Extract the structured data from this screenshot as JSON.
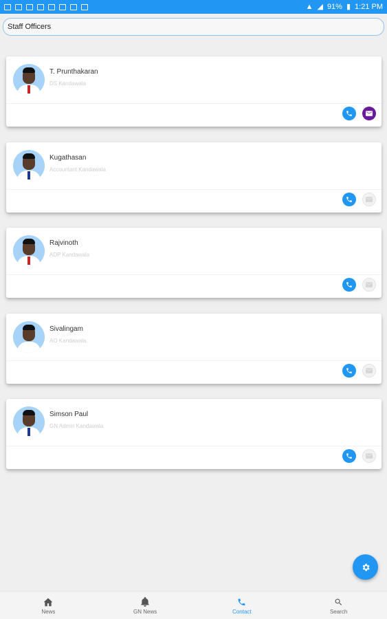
{
  "status_bar": {
    "battery": "91%",
    "time": "1:21 PM"
  },
  "search": {
    "value": "Staff Officers",
    "placeholder": "Staff Officers"
  },
  "contacts": [
    {
      "name": "T. Prunthakaran",
      "role": "DS Kandawala",
      "tie": "red",
      "email_active": true
    },
    {
      "name": "Kugathasan",
      "role": "Accountant Kandawala",
      "tie": "blue",
      "email_active": false
    },
    {
      "name": "Rajvinoth",
      "role": "ADP Kandawala",
      "tie": "red",
      "email_active": false
    },
    {
      "name": "Sivalingam",
      "role": "AO Kandawala",
      "tie": "none",
      "email_active": false
    },
    {
      "name": "Simson Paul",
      "role": "GN Admin Kandawala",
      "tie": "blue",
      "email_active": false
    }
  ],
  "bottom_nav": [
    {
      "label": "News",
      "icon": "home-icon",
      "active": false
    },
    {
      "label": "GN News",
      "icon": "bell-icon",
      "active": false
    },
    {
      "label": "Contact",
      "icon": "phone-icon",
      "active": true
    },
    {
      "label": "Search",
      "icon": "search-icon",
      "active": false
    }
  ],
  "colors": {
    "accent": "#2196f3",
    "email_active": "#6a1b9a"
  },
  "fab": {
    "icon": "gear-icon"
  }
}
